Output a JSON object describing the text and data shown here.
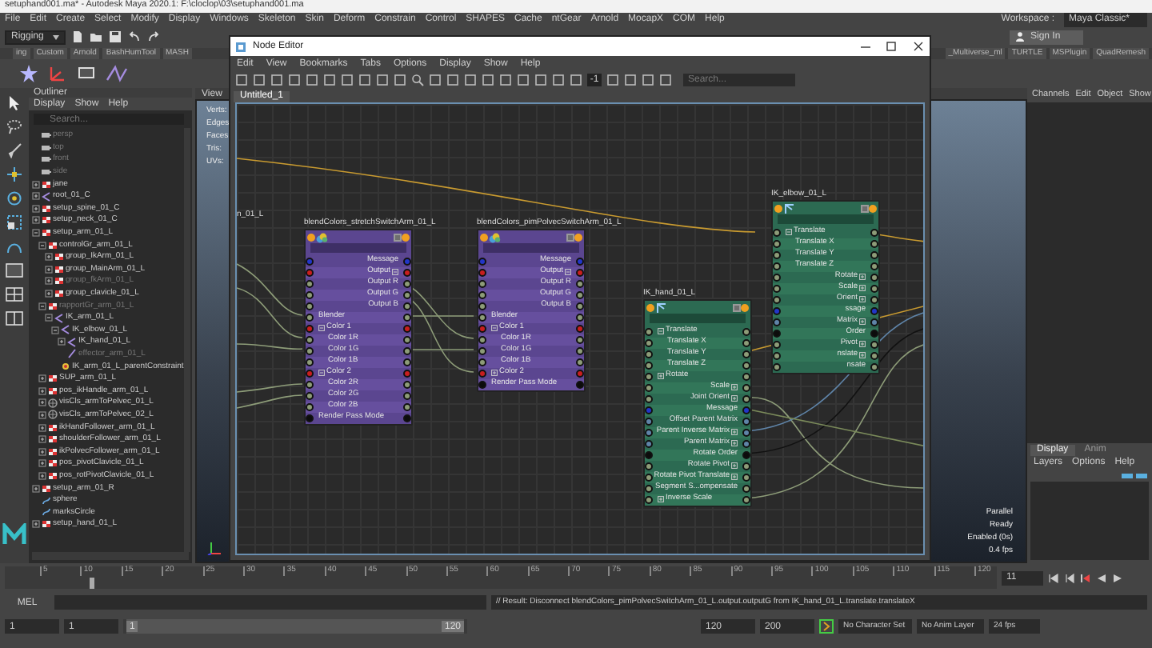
{
  "app_title": "setuphand001.ma* - Autodesk Maya 2020.1: F:\\cloclop\\03\\setuphand001.ma",
  "menu": [
    "File",
    "Edit",
    "Create",
    "Select",
    "Modify",
    "Display",
    "Windows",
    "Skeleton",
    "Skin",
    "Deform",
    "Constrain",
    "Control",
    "SHAPES",
    "Cache",
    "ntGear",
    "Arnold",
    "MocapX",
    "COM",
    "Help"
  ],
  "workspace": {
    "label": "Workspace :",
    "value": "Maya Classic*"
  },
  "status_line": {
    "menu_set": "Rigging",
    "sign_in": "Sign In"
  },
  "shelf": {
    "tabs_left": [
      {
        "label": "ing",
        "selected": false
      },
      {
        "label": "Custom",
        "selected": false
      },
      {
        "label": "Arnold",
        "selected": false
      },
      {
        "label": "BashHumTool",
        "selected": false
      },
      {
        "label": "MASH",
        "selected": false
      }
    ],
    "tabs_right": [
      {
        "label": "_Multiverse_ml",
        "selected": false
      },
      {
        "label": "TURTLE",
        "selected": false
      },
      {
        "label": "MSPlugin",
        "selected": false
      },
      {
        "label": "QuadRemesh",
        "selected": false
      }
    ]
  },
  "outliner": {
    "title": "Outliner",
    "menu": [
      "Display",
      "Show",
      "Help"
    ],
    "search_placeholder": "Search...",
    "items": [
      {
        "label": "persp",
        "kind": "camera",
        "hidden": true
      },
      {
        "label": "top",
        "kind": "camera",
        "hidden": true
      },
      {
        "label": "front",
        "kind": "camera",
        "hidden": true
      },
      {
        "label": "side",
        "kind": "camera",
        "hidden": true
      },
      {
        "label": "jane",
        "kind": "transform",
        "hidden": false,
        "expanded": false
      },
      {
        "label": "root_01_C",
        "kind": "joint",
        "hidden": false,
        "expanded": false
      },
      {
        "label": "setup_spine_01_C",
        "kind": "transform",
        "hidden": false,
        "expanded": false
      },
      {
        "label": "setup_neck_01_C",
        "kind": "transform",
        "hidden": false,
        "expanded": false
      },
      {
        "label": "setup_arm_01_L",
        "kind": "transform",
        "hidden": false,
        "expanded": true,
        "children": [
          {
            "label": "controlGr_arm_01_L",
            "kind": "transform",
            "hidden": false,
            "expanded": true,
            "children": [
              {
                "label": "group_IkArm_01_L",
                "kind": "transform",
                "hidden": false,
                "expanded": false
              },
              {
                "label": "group_MainArm_01_L",
                "kind": "transform",
                "hidden": false,
                "expanded": false
              },
              {
                "label": "group_fkArm_01_L",
                "kind": "transform",
                "hidden": true,
                "expanded": false
              },
              {
                "label": "group_clavicle_01_L",
                "kind": "transform",
                "hidden": false,
                "expanded": false
              }
            ]
          },
          {
            "label": "rapportGr_arm_01_L",
            "kind": "transform",
            "hidden": true,
            "expanded": true,
            "children": [
              {
                "label": "IK_arm_01_L",
                "kind": "joint",
                "hidden": false,
                "expanded": true,
                "children": [
                  {
                    "label": "IK_elbow_01_L",
                    "kind": "joint",
                    "hidden": false,
                    "expanded": true,
                    "children": [
                      {
                        "label": "IK_hand_01_L",
                        "kind": "joint",
                        "hidden": false,
                        "expanded": false
                      },
                      {
                        "label": "effector_arm_01_L",
                        "kind": "effector",
                        "hidden": true
                      }
                    ]
                  },
                  {
                    "label": "IK_arm_01_L_parentConstraint",
                    "kind": "constraint",
                    "hidden": false
                  }
                ]
              }
            ]
          },
          {
            "label": "SUP_arm_01_L",
            "kind": "transform",
            "hidden": false,
            "expanded": false
          },
          {
            "label": "pos_ikHandle_arm_01_L",
            "kind": "transform",
            "hidden": false,
            "expanded": false
          },
          {
            "label": "visCls_armToPelvec_01_L",
            "kind": "cluster",
            "hidden": false,
            "expanded": false
          },
          {
            "label": "visCls_armToPelvec_02_L",
            "kind": "cluster",
            "hidden": false,
            "expanded": false
          },
          {
            "label": "ikHandFollower_arm_01_L",
            "kind": "transform",
            "hidden": false,
            "expanded": false
          },
          {
            "label": "shoulderFollower_arm_01_L",
            "kind": "transform",
            "hidden": false,
            "expanded": false
          },
          {
            "label": "ikPolvecFollower_arm_01_L",
            "kind": "transform",
            "hidden": false,
            "expanded": false
          },
          {
            "label": "pos_pivotClavicle_01_L",
            "kind": "transform",
            "hidden": false,
            "expanded": false
          },
          {
            "label": "pos_rotPivotClavicle_01_L",
            "kind": "transform",
            "hidden": false,
            "expanded": false
          }
        ]
      },
      {
        "label": "setup_arm_01_R",
        "kind": "transform",
        "hidden": false,
        "expanded": false
      },
      {
        "label": "sphere",
        "kind": "curve",
        "hidden": false
      },
      {
        "label": "marksCircle",
        "kind": "curve",
        "hidden": false
      },
      {
        "label": "setup_hand_01_L",
        "kind": "transform",
        "hidden": false,
        "expanded": false
      }
    ]
  },
  "viewport": {
    "menu": [
      "View"
    ],
    "hud": [
      "Verts:",
      "Edges:",
      "Faces:",
      "Tris:",
      "UVs:"
    ],
    "status_hud": [
      "Parallel",
      "Ready",
      "Enabled (0s)",
      "0.4 fps"
    ]
  },
  "channel_box": {
    "menu": [
      "Channels",
      "Edit",
      "Object",
      "Show"
    ]
  },
  "layer_editor": {
    "tabs": [
      {
        "label": "Display",
        "selected": true
      },
      {
        "label": "Anim",
        "selected": false
      }
    ],
    "menu": [
      "Layers",
      "Options",
      "Help"
    ]
  },
  "node_editor": {
    "title": "Node Editor",
    "menu": [
      "Edit",
      "View",
      "Bookmarks",
      "Tabs",
      "Options",
      "Display",
      "Show",
      "Help"
    ],
    "toolbar_field": "-1",
    "search_placeholder": "Search...",
    "tabs": [
      {
        "label": "Untitled_1",
        "selected": true
      }
    ],
    "offscreen_label": "n_01_L",
    "nodes": [
      {
        "title": "blendColors_stretchSwitchArm_01_L",
        "kind": "blend",
        "attributes": [
          {
            "label": "Message",
            "kind": "message",
            "output": true
          },
          {
            "label": "Output",
            "kind": "compound",
            "output": true,
            "expanded": true,
            "children": [
              {
                "label": "Output R",
                "kind": "float",
                "output": true
              },
              {
                "label": "Output G",
                "kind": "float",
                "output": true
              },
              {
                "label": "Output B",
                "kind": "float",
                "output": true
              }
            ]
          },
          {
            "label": "Blender",
            "kind": "float",
            "output": false
          },
          {
            "label": "Color 1",
            "kind": "compound",
            "output": false,
            "expanded": true,
            "children": [
              {
                "label": "Color 1R",
                "kind": "float",
                "output": false
              },
              {
                "label": "Color 1G",
                "kind": "float",
                "output": false
              },
              {
                "label": "Color 1B",
                "kind": "float",
                "output": false
              }
            ]
          },
          {
            "label": "Color 2",
            "kind": "compound",
            "output": false,
            "expanded": true,
            "children": [
              {
                "label": "Color 2R",
                "kind": "float",
                "output": false
              },
              {
                "label": "Color 2G",
                "kind": "float",
                "output": false
              },
              {
                "label": "Color 2B",
                "kind": "float",
                "output": false
              }
            ]
          },
          {
            "label": "Render Pass Mode",
            "kind": "enum",
            "output": false
          }
        ]
      },
      {
        "title": "blendColors_pimPolvecSwitchArm_01_L",
        "kind": "blend",
        "attributes": [
          {
            "label": "Message",
            "kind": "message",
            "output": true
          },
          {
            "label": "Output",
            "kind": "compound",
            "output": true,
            "expanded": true,
            "children": [
              {
                "label": "Output R",
                "kind": "float",
                "output": true
              },
              {
                "label": "Output G",
                "kind": "float",
                "output": true
              },
              {
                "label": "Output B",
                "kind": "float",
                "output": true
              }
            ]
          },
          {
            "label": "Blender",
            "kind": "float",
            "output": false
          },
          {
            "label": "Color 1",
            "kind": "compound",
            "output": false,
            "expanded": true,
            "children": [
              {
                "label": "Color 1R",
                "kind": "float",
                "output": false
              },
              {
                "label": "Color 1G",
                "kind": "float",
                "output": false
              },
              {
                "label": "Color 1B",
                "kind": "float",
                "output": false
              }
            ]
          },
          {
            "label": "Color 2",
            "kind": "compound",
            "output": false,
            "expanded": false
          },
          {
            "label": "Render Pass Mode",
            "kind": "enum",
            "output": false
          }
        ]
      },
      {
        "title": "IK_elbow_01_L",
        "kind": "joint",
        "attributes": [
          {
            "label": "Translate",
            "kind": "float",
            "output": false,
            "expanded": true,
            "children": [
              {
                "label": "Translate X",
                "kind": "float",
                "output": false
              },
              {
                "label": "Translate Y",
                "kind": "float",
                "output": false
              },
              {
                "label": "Translate Z",
                "kind": "float",
                "output": false
              }
            ]
          },
          {
            "label": "Rotate",
            "kind": "float",
            "output": true,
            "expanded": false
          },
          {
            "label": "Scale",
            "kind": "float",
            "output": true,
            "expanded": false
          },
          {
            "label": "Orient",
            "kind": "float",
            "output": true,
            "expanded": false
          },
          {
            "label": "ssage",
            "kind": "message",
            "output": true
          },
          {
            "label": "Matrix",
            "kind": "matrix",
            "output": true,
            "expanded": false
          },
          {
            "label": "Order",
            "kind": "enum",
            "output": true
          },
          {
            "label": "Pivot",
            "kind": "float",
            "output": true,
            "expanded": false
          },
          {
            "label": "nslate",
            "kind": "float",
            "output": true,
            "expanded": false
          },
          {
            "label": "nsate",
            "kind": "float",
            "output": true
          }
        ]
      },
      {
        "title": "IK_hand_01_L",
        "kind": "joint",
        "attributes": [
          {
            "label": "Translate",
            "kind": "float",
            "output": false,
            "expanded": true,
            "children": [
              {
                "label": "Translate X",
                "kind": "float",
                "output": false
              },
              {
                "label": "Translate Y",
                "kind": "float",
                "output": false
              },
              {
                "label": "Translate Z",
                "kind": "float",
                "output": false
              }
            ]
          },
          {
            "label": "Rotate",
            "kind": "float",
            "output": false,
            "expanded": false
          },
          {
            "label": "Scale",
            "kind": "float",
            "output": true,
            "expanded": false
          },
          {
            "label": "Joint Orient",
            "kind": "float",
            "output": true,
            "expanded": false
          },
          {
            "label": "Message",
            "kind": "message",
            "output": true
          },
          {
            "label": "Offset Parent Matrix",
            "kind": "matrix",
            "output": true
          },
          {
            "label": "Parent Inverse Matrix",
            "kind": "matrix",
            "output": true,
            "expanded": false
          },
          {
            "label": "Parent Matrix",
            "kind": "matrix",
            "output": true,
            "expanded": false
          },
          {
            "label": "Rotate Order",
            "kind": "enum",
            "output": true
          },
          {
            "label": "Rotate Pivot",
            "kind": "float",
            "output": true,
            "expanded": false
          },
          {
            "label": "Rotate Pivot Translate",
            "kind": "float",
            "output": true,
            "expanded": false
          },
          {
            "label": "Segment S...ompensate",
            "kind": "float",
            "output": true
          },
          {
            "label": "Inverse Scale",
            "kind": "float",
            "output": false,
            "expanded": false
          }
        ]
      }
    ]
  },
  "timeline": {
    "ticks": [
      "5",
      "10",
      "15",
      "20",
      "25",
      "30",
      "35",
      "40",
      "45",
      "50",
      "55",
      "60",
      "65",
      "70",
      "75",
      "80",
      "85",
      "90",
      "95",
      "100",
      "105",
      "110",
      "115",
      "120"
    ],
    "playhead": {
      "level": 0.085
    },
    "current_frame": "11"
  },
  "command_line": {
    "label": "MEL",
    "result": "// Result: Disconnect blendColors_pimPolvecSwitchArm_01_L.output.outputG from IK_hand_01_L.translate.translateX"
  },
  "range_bar": {
    "start": "1",
    "playback_start": "1",
    "range_start": "1",
    "range_end": "120",
    "playback_end": "120",
    "end": "200",
    "fill": {
      "level": 1
    },
    "character_set": "No Character Set",
    "anim_layer": "No Anim Layer",
    "fps": "24 fps"
  }
}
